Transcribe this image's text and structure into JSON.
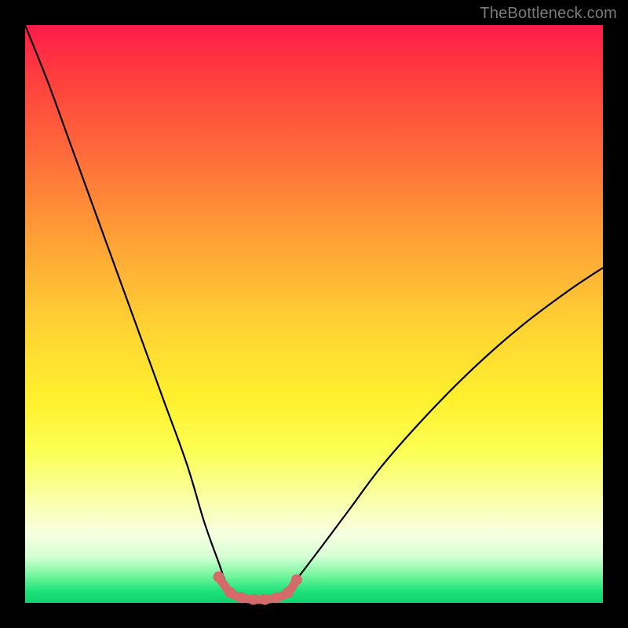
{
  "watermark": "TheBottleneck.com",
  "colors": {
    "page_bg": "#000000",
    "curve_stroke": "#000000",
    "overlay_stroke": "#d46a6a",
    "overlay_fill": "#d46a6a",
    "gradient_stops": [
      "#ff1a4a",
      "#ff3b3f",
      "#ff6a3a",
      "#ffa436",
      "#ffd233",
      "#fff12e",
      "#fbff55",
      "#faffa8",
      "#f7ffe0",
      "#d6ffd6",
      "#7cf7a0",
      "#1de27a",
      "#0fd36e"
    ]
  },
  "chart_data": {
    "type": "line",
    "title": "",
    "xlabel": "",
    "ylabel": "",
    "xlim": [
      0,
      100
    ],
    "ylim": [
      0,
      100
    ],
    "grid": false,
    "legend": false,
    "series": [
      {
        "name": "bottleneck-curve",
        "x": [
          0,
          4,
          8,
          12,
          16,
          20,
          24,
          28,
          31,
          33.5,
          35,
          37,
          39,
          41,
          43,
          46,
          50,
          56,
          62,
          70,
          78,
          86,
          94,
          100
        ],
        "y": [
          100,
          90,
          79,
          68,
          57,
          46,
          35,
          24,
          14,
          7,
          3,
          1,
          0.5,
          0.5,
          1,
          3,
          8,
          16,
          24,
          33,
          41,
          48,
          54,
          58
        ]
      }
    ],
    "overlay": {
      "name": "flat-bottom-marker",
      "points_x": [
        33.5,
        35.5,
        37.5,
        39.5,
        41.5,
        43.5,
        45.5,
        47
      ],
      "points_y": [
        4.5,
        1.8,
        0.9,
        0.6,
        0.6,
        0.9,
        1.8,
        4
      ]
    }
  }
}
